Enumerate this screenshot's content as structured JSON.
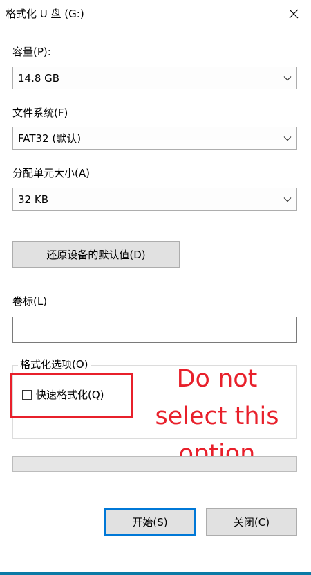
{
  "window": {
    "title": "格式化 U 盘 (G:)",
    "close_icon": "close-x-icon"
  },
  "capacity": {
    "label": "容量(P):",
    "value": "14.8 GB"
  },
  "filesystem": {
    "label": "文件系统(F)",
    "value": "FAT32 (默认)"
  },
  "allocation": {
    "label": "分配单元大小(A)",
    "value": "32 KB"
  },
  "restore_defaults": {
    "label": "还原设备的默认值(D)"
  },
  "volume_label": {
    "label": "卷标(L)",
    "value": ""
  },
  "format_options": {
    "label": "格式化选项(O)",
    "quick_format": {
      "label": "快速格式化(Q)",
      "checked": false
    }
  },
  "annotation": {
    "line1": "Do not",
    "line2": "select this",
    "line3": "option",
    "color": "#e8202b"
  },
  "progress": {
    "value": 0
  },
  "buttons": {
    "start": "开始(S)",
    "close": "关闭(C)"
  },
  "colors": {
    "default_button_border": "#0078d7",
    "annotation_red": "#e8202b"
  }
}
